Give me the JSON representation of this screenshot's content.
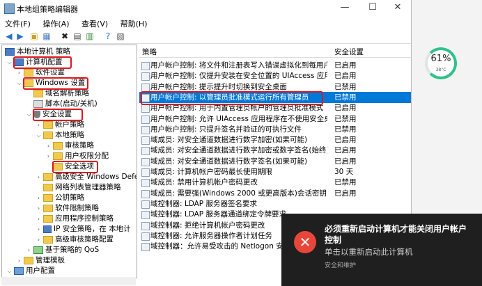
{
  "window": {
    "title": "本地组策略编辑器",
    "minimize": "—",
    "maximize": "☐",
    "close": "✕"
  },
  "menu": [
    "文件(F)",
    "操作(A)",
    "查看(V)",
    "帮助(H)"
  ],
  "tree": [
    {
      "label": "本地计算机 策略"
    },
    {
      "label": "计算机配置"
    },
    {
      "label": "软件设置"
    },
    {
      "label": "Windows 设置"
    },
    {
      "label": "域名解析策略"
    },
    {
      "label": "脚本(启动/关机)"
    },
    {
      "label": "安全设置"
    },
    {
      "label": "帐户策略"
    },
    {
      "label": "本地策略"
    },
    {
      "label": "审核策略"
    },
    {
      "label": "用户权限分配"
    },
    {
      "label": "安全选项"
    },
    {
      "label": "高级安全 Windows Defe"
    },
    {
      "label": "网络列表管理器策略"
    },
    {
      "label": "公钥策略"
    },
    {
      "label": "软件限制策略"
    },
    {
      "label": "应用程序控制策略"
    },
    {
      "label": "IP 安全策略，在 本地计"
    },
    {
      "label": "高级审核策略配置"
    },
    {
      "label": "基于策略的 QoS"
    },
    {
      "label": "管理模板"
    },
    {
      "label": "用户配置"
    }
  ],
  "list": {
    "col_policy": "策略",
    "col_setting": "安全设置",
    "rows": [
      {
        "policy": "用户帐户控制: 将文件和注册表写入错误虚拟化到每用户位置",
        "value": "已启用"
      },
      {
        "policy": "用户帐户控制: 仅提升安装在安全位置的 UIAccess 应用程序",
        "value": "已启用"
      },
      {
        "policy": "用户帐户控制: 提示提升时切换到安全桌面",
        "value": "已禁用"
      },
      {
        "policy": "用户帐户控制: 以管理员批准模式运行所有管理员",
        "value": "已禁用"
      },
      {
        "policy": "用户帐户控制: 用于内置管理员帐户的管理员批准模式",
        "value": "已启用"
      },
      {
        "policy": "用户帐户控制: 允许 UIAccess 应用程序在不使用安全桌面的...",
        "value": "已禁用"
      },
      {
        "policy": "用户帐户控制: 只提升签名并验证的可执行文件",
        "value": "已禁用"
      },
      {
        "policy": "域成员: 对安全通道数据进行数字加密(如果可能)",
        "value": "已启用"
      },
      {
        "policy": "域成员: 对安全通道数据进行数字加密或数字签名(始终)",
        "value": "已启用"
      },
      {
        "policy": "域成员: 对安全通道数据进行数字签名(如果可能)",
        "value": "已启用"
      },
      {
        "policy": "域成员: 计算机帐户密码最长使用期限",
        "value": "30 天"
      },
      {
        "policy": "域成员: 禁用计算机帐户密码更改",
        "value": "已禁用"
      },
      {
        "policy": "域成员: 需要强(Windows 2000 或更高版本)会话密钥",
        "value": "已启用"
      },
      {
        "policy": "域控制器: LDAP 服务器签名要求",
        "value": ""
      },
      {
        "policy": "域控制器: LDAP 服务器通道绑定令牌要求",
        "value": ""
      },
      {
        "policy": "域控制器: 拒绝计算机帐户密码更改",
        "value": ""
      },
      {
        "policy": "域控制器: 允许服务器操作者计划任务",
        "value": ""
      },
      {
        "policy": "域控制器：允许易受攻击的 Netlogon 安全通道",
        "value": ""
      }
    ]
  },
  "battery": {
    "percent": "61%",
    "temp": "38°C",
    "level": 0.61
  },
  "toast": {
    "title": "必须重新启动计算机才能关闭用户帐户控制",
    "body": "单击以重新启动此计算机",
    "source": "安全和维护",
    "icon": "error-x-icon"
  }
}
